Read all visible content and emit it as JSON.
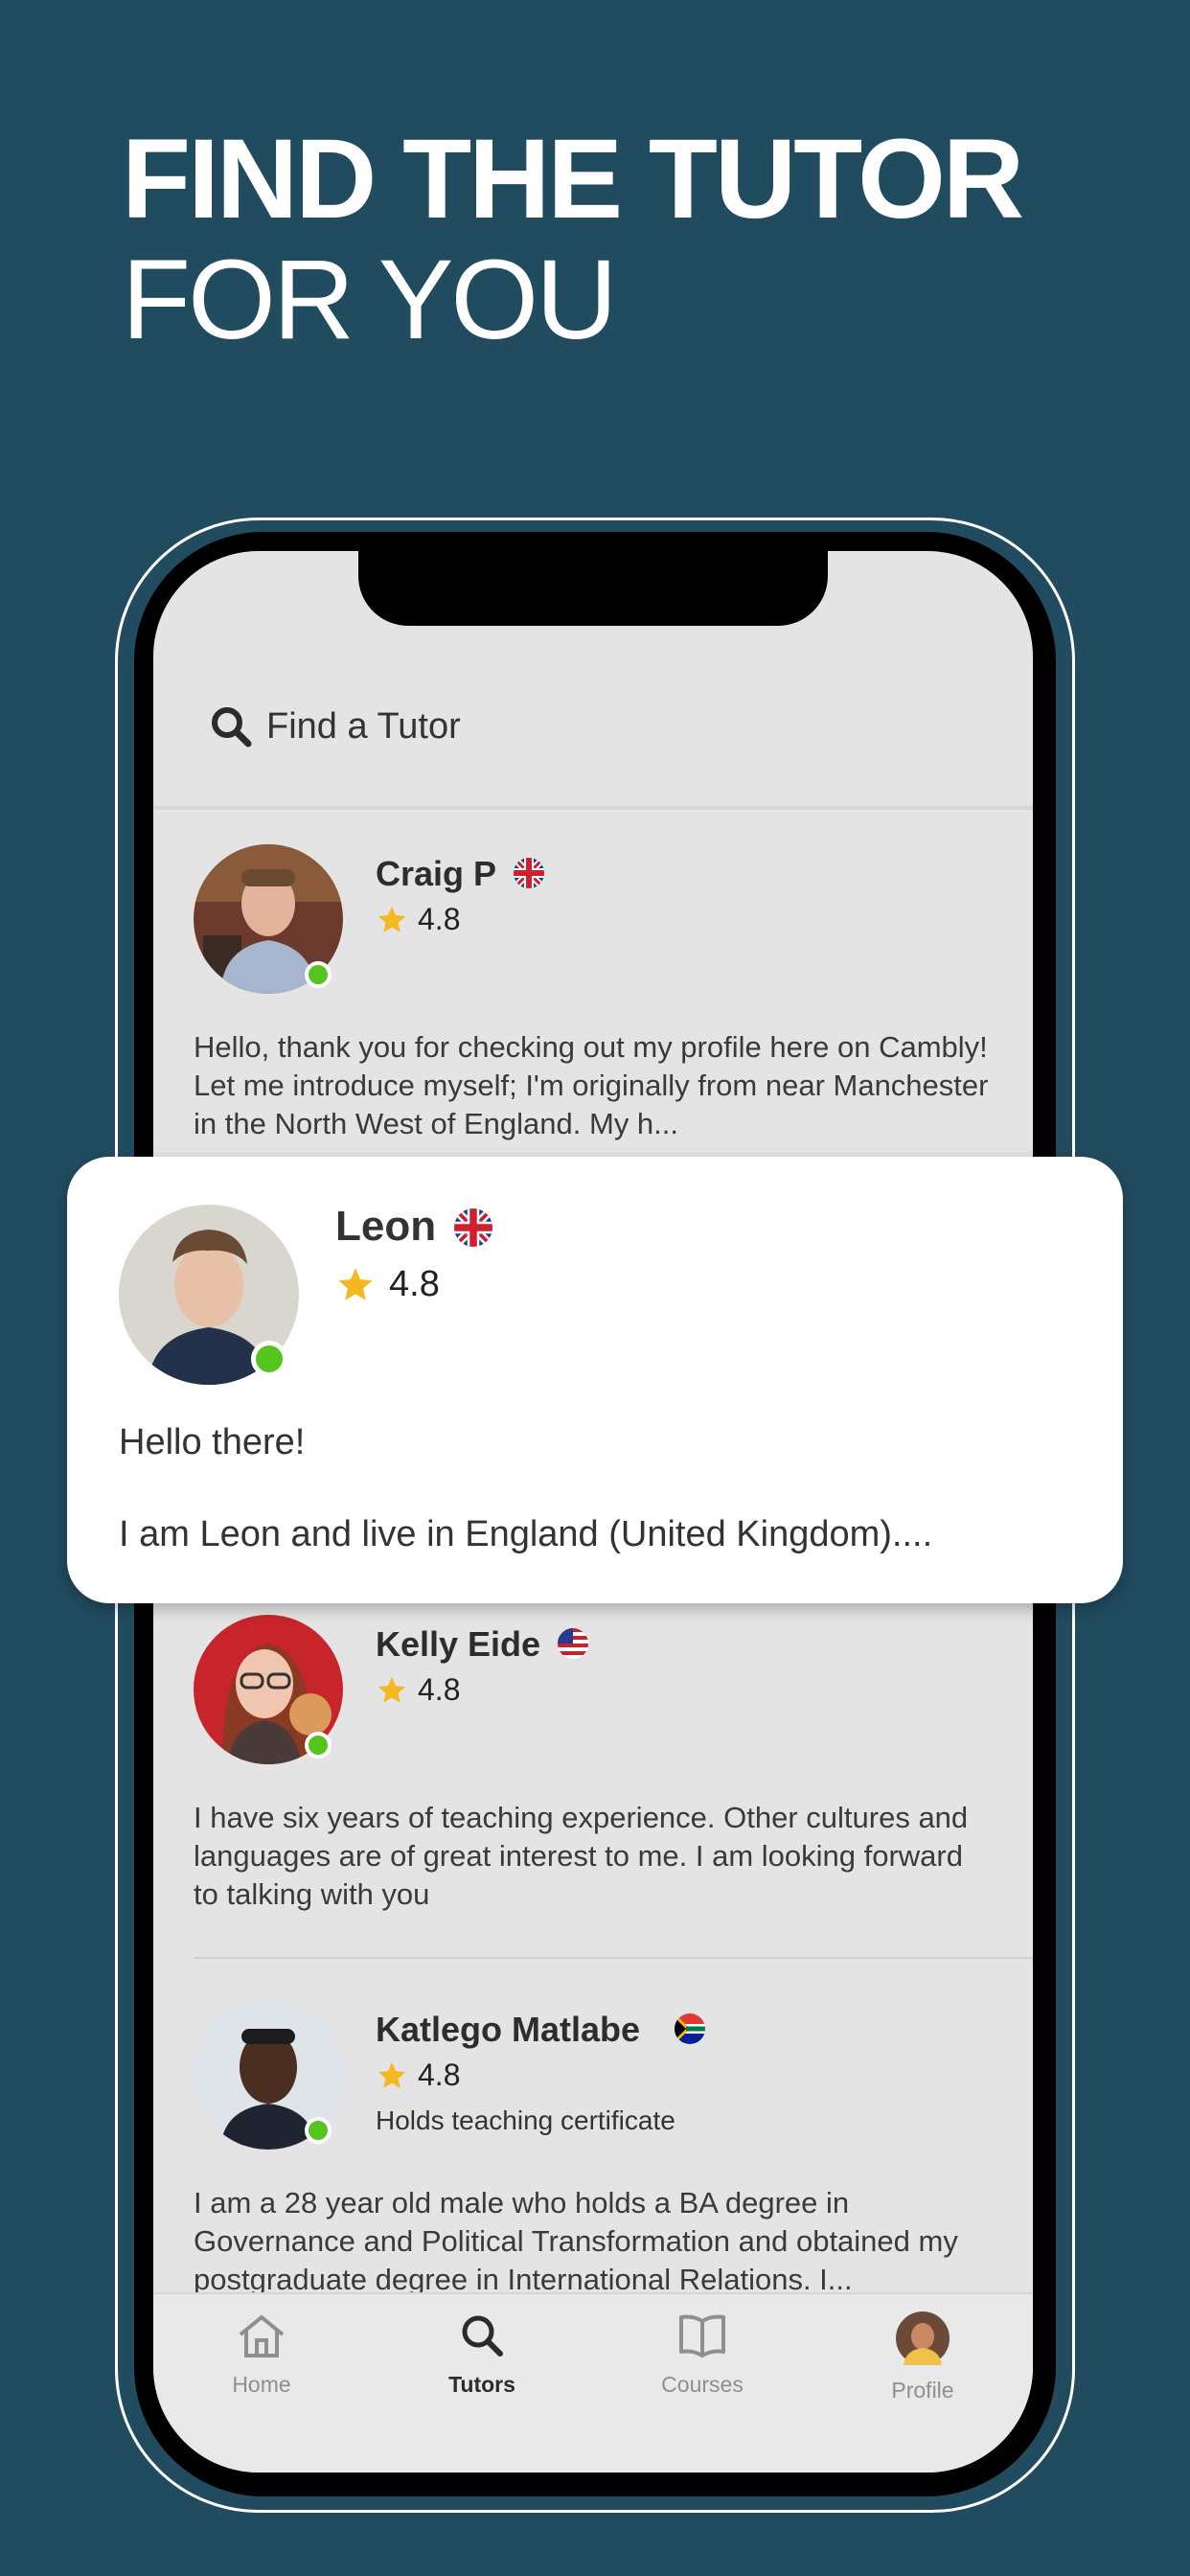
{
  "headline": {
    "line1": "FIND THE TUTOR",
    "line2": "FOR YOU"
  },
  "search": {
    "label": "Find a Tutor"
  },
  "tutors": [
    {
      "name": "Craig P",
      "flag": "uk-flag",
      "rating": "4.8",
      "bio": "Hello, thank you for checking out my profile here on Cambly!  Let me introduce myself; I'm originally from near Manchester in the North West of England. My h..."
    },
    {
      "name": "Kelly Eide",
      "flag": "us-flag",
      "rating": "4.8",
      "bio": "I have six years of teaching experience. Other cultures and languages are of great interest to me. I am looking forward to talking with you"
    },
    {
      "name": "Katlego Matlabe",
      "flag": "za-flag",
      "rating": "4.8",
      "subtitle": "Holds teaching certificate",
      "bio": "I am a 28 year old male who holds a BA degree in Governance and Political Transformation and obtained my postgraduate degree in International Relations. I..."
    }
  ],
  "featured": {
    "name": "Leon",
    "flag": "uk-flag",
    "rating": "4.8",
    "bio_line1": "Hello there!",
    "bio_line2": "I am Leon and live in England (United Kingdom)...."
  },
  "tabs": [
    {
      "label": "Home",
      "icon": "home-icon"
    },
    {
      "label": "Tutors",
      "icon": "search-icon"
    },
    {
      "label": "Courses",
      "icon": "book-icon"
    },
    {
      "label": "Profile",
      "icon": "avatar"
    }
  ],
  "colors": {
    "background": "#214b5f",
    "online": "#56c41e",
    "star": "#f5b820",
    "screen": "#e4e4e4"
  }
}
